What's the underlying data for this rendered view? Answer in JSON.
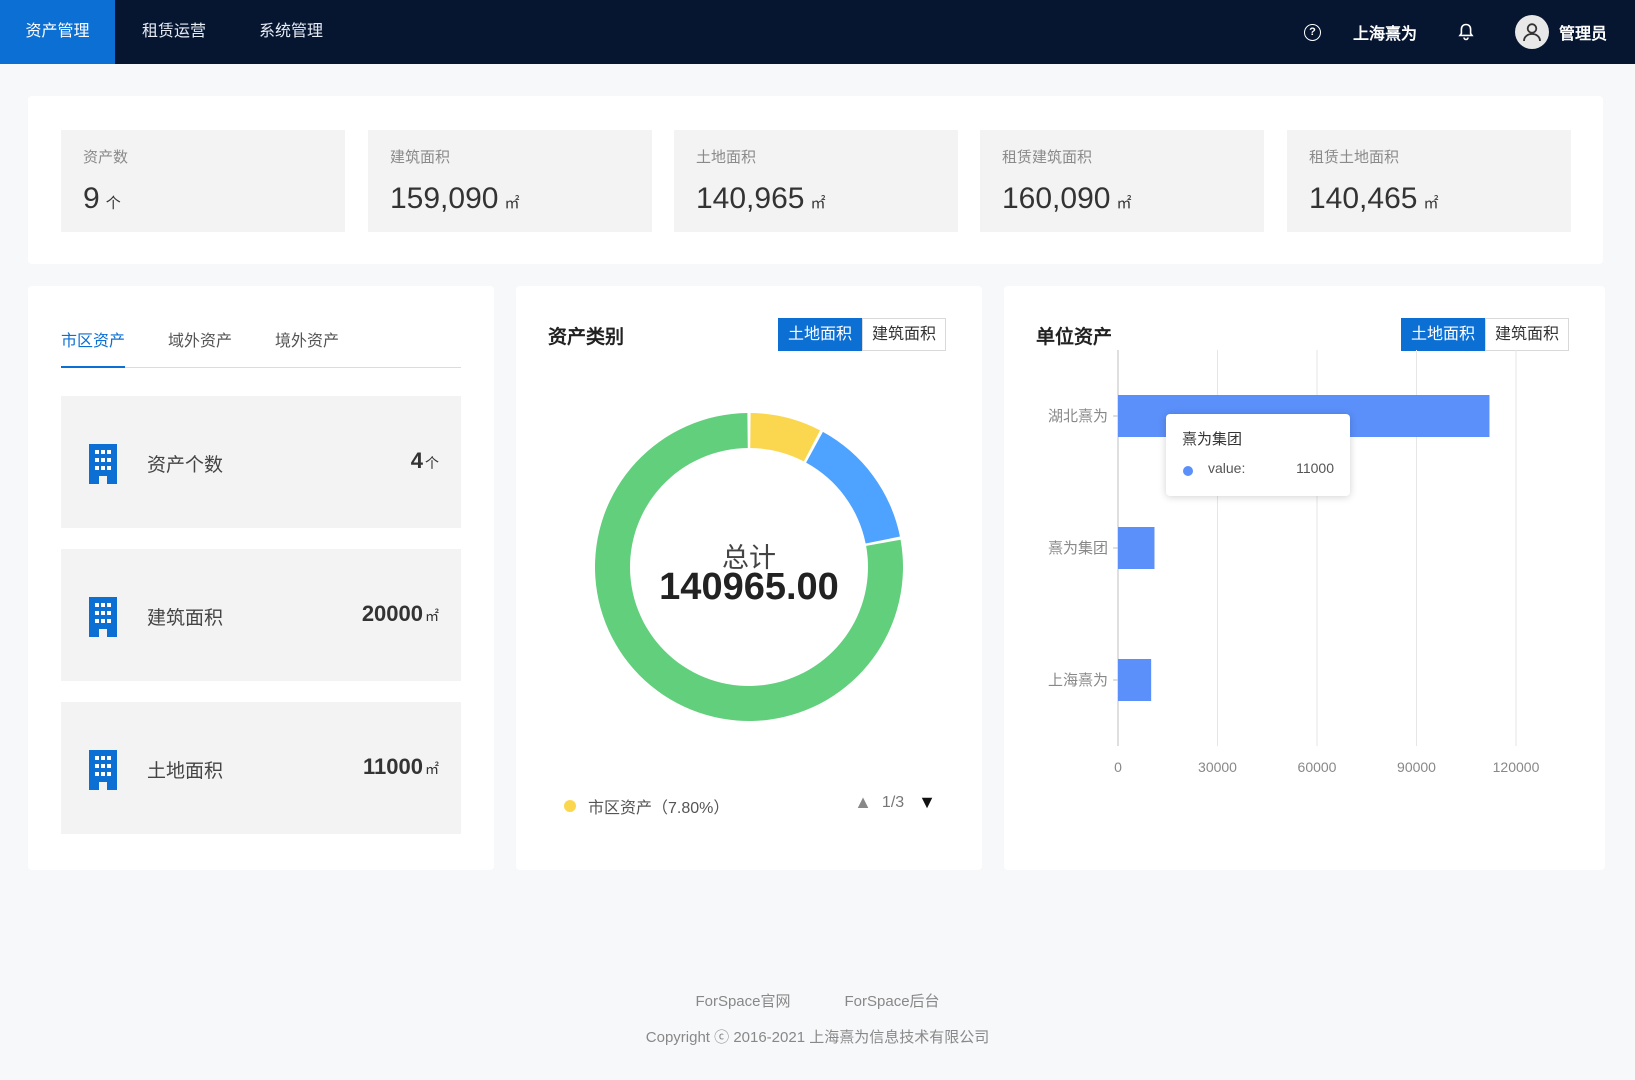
{
  "header": {
    "nav": [
      "资产管理",
      "租赁运营",
      "系统管理"
    ],
    "help_icon": "question-circle-icon",
    "org_name": "上海熹为",
    "bell_icon": "bell-icon",
    "avatar_icon": "user-icon",
    "user_name": "管理员"
  },
  "summary": [
    {
      "label": "资产数",
      "value": "9",
      "unit": "个"
    },
    {
      "label": "建筑面积",
      "value": "159,090",
      "unit": "㎡"
    },
    {
      "label": "土地面积",
      "value": "140,965",
      "unit": "㎡"
    },
    {
      "label": "租赁建筑面积",
      "value": "160,090",
      "unit": "㎡"
    },
    {
      "label": "租赁土地面积",
      "value": "140,465",
      "unit": "㎡"
    }
  ],
  "left_panel": {
    "tabs": [
      "市区资产",
      "域外资产",
      "境外资产"
    ],
    "active_tab": "市区资产",
    "items": [
      {
        "icon": "building-icon",
        "label": "资产个数",
        "value": "4",
        "unit": "个"
      },
      {
        "icon": "building-icon",
        "label": "建筑面积",
        "value": "20000",
        "unit": "㎡"
      },
      {
        "icon": "building-icon",
        "label": "土地面积",
        "value": "11000",
        "unit": "㎡"
      }
    ]
  },
  "category_panel": {
    "title": "资产类别",
    "toggle": [
      "土地面积",
      "建筑面积"
    ],
    "center_label": "总计",
    "center_value": "140965.00",
    "legend_item": "市区资产（7.80%）",
    "pager": {
      "up_icon": "triangle-up-icon",
      "page": "1/3",
      "down_icon": "triangle-down-icon"
    }
  },
  "unit_panel": {
    "title": "单位资产",
    "toggle": [
      "土地面积",
      "建筑面积"
    ],
    "tooltip": {
      "title": "熹为集团",
      "key": "value:",
      "value": "11000"
    }
  },
  "chart_data": [
    {
      "type": "pie",
      "donut": true,
      "slices": [
        {
          "name": "市区资产",
          "percent": 7.8,
          "color": "#fad74f"
        },
        {
          "name": "",
          "percent": 14.2,
          "color": "#4da3ff"
        },
        {
          "name": "",
          "percent": 78.0,
          "color": "#62cf7c"
        }
      ]
    },
    {
      "type": "bar",
      "orientation": "horizontal",
      "categories": [
        "湖北熹为",
        "熹为集团",
        "上海熹为"
      ],
      "values": [
        112000,
        11000,
        10000
      ],
      "xlim": [
        0,
        120000
      ],
      "xticks": [
        "0",
        "30000",
        "60000",
        "90000",
        "120000"
      ],
      "color": "#5b8ff9",
      "grid": true
    }
  ],
  "footer": {
    "links": [
      "ForSpace官网",
      "ForSpace后台"
    ],
    "copyright": "Copyright ⓒ 2016-2021 上海熹为信息技术有限公司"
  }
}
